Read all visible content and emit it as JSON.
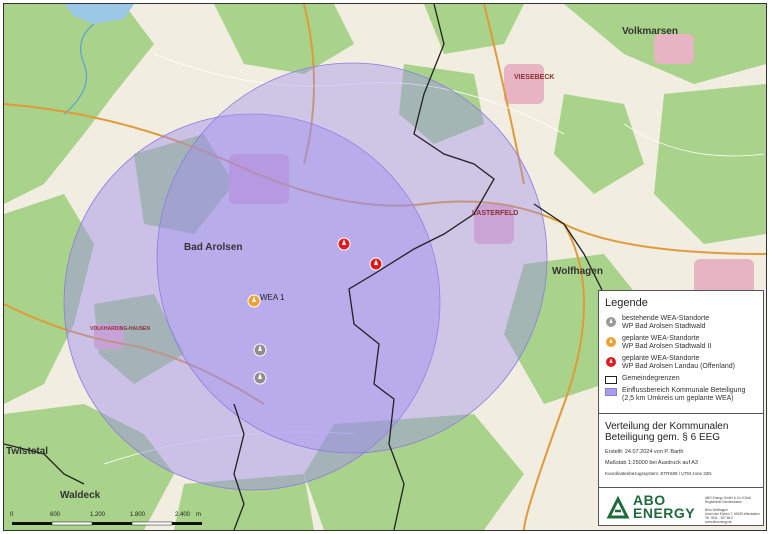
{
  "map": {
    "place_labels": {
      "bad_arolsen": "Bad Arolsen",
      "wolfhagen": "Wolfhagen",
      "volkmarsen": "Volkmarsen",
      "twistetal": "Twistetal",
      "waldeck": "Waldeck",
      "viesebeck": "VIESEBECK",
      "lasterfeld": "LASTERFELD",
      "volkhardinghausen": "VOLKHARDING-HAUSEN"
    },
    "turbine_labels": {
      "wea1": "WEA 1"
    },
    "scalebar": {
      "ticks": [
        "0",
        "600",
        "1.200",
        "1.800",
        "2.400"
      ],
      "unit": "m"
    }
  },
  "legend": {
    "title": "Legende",
    "items": [
      {
        "line1": "bestehende WEA-Standorte",
        "line2": "WP Bad Arolsen Stadtwald",
        "color": "#9a9a9a"
      },
      {
        "line1": "geplante WEA-Standorte",
        "line2": "WP Bad Arolsen Stadtwald II",
        "color": "#f0a030"
      },
      {
        "line1": "geplante WEA-Standorte",
        "line2": "WP Bad Arolsen Landau (Offenland)",
        "color": "#e01b1b"
      }
    ],
    "boundary": "Gemeindegrenzen",
    "influence_line1": "Einflussbereich Kommunale Beteiligung",
    "influence_line2": "(2,5 km Umkreis um geplante WEA)",
    "influence_color": "#a99ce8"
  },
  "info": {
    "title_line1": "Verteilung der Kommunalen",
    "title_line2": "Beteiligung gem. § 6 EEG",
    "created": "Erstellt: 24.07.2024 von P. Barth",
    "scale": "Maßstab 1:25000   bei Ausdruck auf A3",
    "crs": "Koordinatenbezugssystem: ETRS89 / UTM zone 32N"
  },
  "logo": {
    "line1": "ABO",
    "line2": "ENERGY",
    "address": "ABO Energy GmbH & Co. KGaA\nRegistrierte Handelsname\n\nBüro Wolfhagen\nUnter den Eichen 7, 65195 Wiesbaden\nTel. 0611 - 267 65-0\nwww.aboenergy.de"
  },
  "colors": {
    "forest": "#a9d38a",
    "open": "#f1ede0",
    "circle": "#9d8cf0",
    "boundary": "#222222",
    "settlement": "#e7b4c4"
  }
}
